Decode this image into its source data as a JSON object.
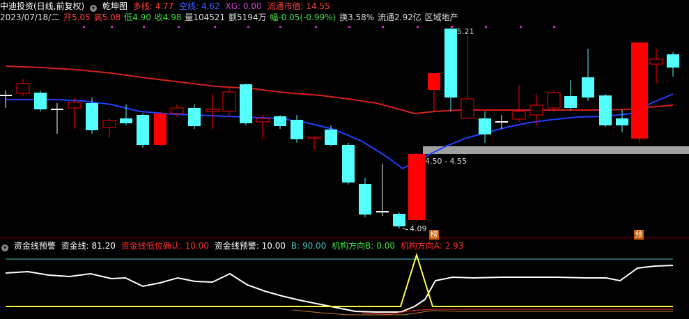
{
  "header": {
    "stock_name": "中迪投资(日线,前复权)",
    "indicator_name": "乾坤图",
    "duo_label": "多线:",
    "duo_value": "4.77",
    "kong_label": "空线:",
    "kong_value": "4.62",
    "xg_label": "XG:",
    "xg_value": "0.00",
    "mktcap_label": "流通市值:",
    "mktcap_value": "14.55"
  },
  "quote": {
    "date": "2023/07/18/二",
    "open_label": "开",
    "open": "5.05",
    "high_label": "高",
    "high": "5.08",
    "low_label": "低",
    "low": "4.90",
    "close_label": "收",
    "close": "4.98",
    "vol_label": "量",
    "vol": "104521",
    "amt_label": "额",
    "amt": "5194万",
    "chg_label": "幅",
    "chg": "-0.05(-0.99%)",
    "turn_label": "换",
    "turn": "3.58%",
    "float_label": "流通",
    "float": "2.92亿",
    "sector": "区域地产"
  },
  "annotations": {
    "high_price": "5.21",
    "low_price": "4.09",
    "zone": "4.50 - 4.55",
    "tag_bang": "榜",
    "tag_yu": "预"
  },
  "sub": {
    "name": "资金线预警",
    "zj_label": "资金线:",
    "zj_value": "81.20",
    "dwqr_label": "资金线低位确认:",
    "dwqr_value": "10.00",
    "yj_label": "资金线预警:",
    "yj_value": "10.00",
    "b_label": "B:",
    "b_value": "90.00",
    "jgb_label": "机构方向B:",
    "jgb_value": "0.00",
    "jga_label": "机构方向A:",
    "jga_value": "2.93"
  },
  "colors": {
    "up": "#ff0000",
    "down": "#54ffff",
    "ma_red": "#d42020",
    "ma_blue": "#2040ff",
    "zone_bar": "#a0a0a0",
    "white_line": "#ffffff",
    "yellow_line": "#ffff40",
    "cyan_line": "#40c0c0"
  },
  "icons": {
    "menu_button": "chevron-down-icon"
  }
}
